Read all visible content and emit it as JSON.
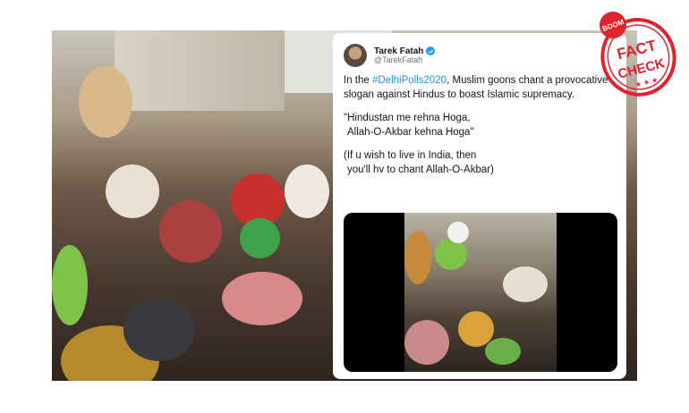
{
  "tweet": {
    "author_name": "Tarek Fatah",
    "author_handle": "@TarekFatah",
    "verified": true,
    "text_prefix": "In the ",
    "hashtag": "#DelhiPolls2020",
    "text_suffix": ", Muslim goons chant a provocative slogan against Hindus to boast Islamic supremacy.",
    "quote_line1": "\"Hindustan me rehna Hoga,",
    "quote_line2": "Allah-O-Akbar kehna Hoga\"",
    "translation_line1": "(If u wish to live in India, then",
    "translation_line2": "you'll hv to chant Allah-O-Akbar)"
  },
  "stamp": {
    "top_label": "BOOM",
    "word1": "FACT",
    "word2": "CHECK",
    "color": "#e0232d"
  },
  "colors": {
    "hashtag": "#1b95e0",
    "verified": "#1da1f2"
  }
}
